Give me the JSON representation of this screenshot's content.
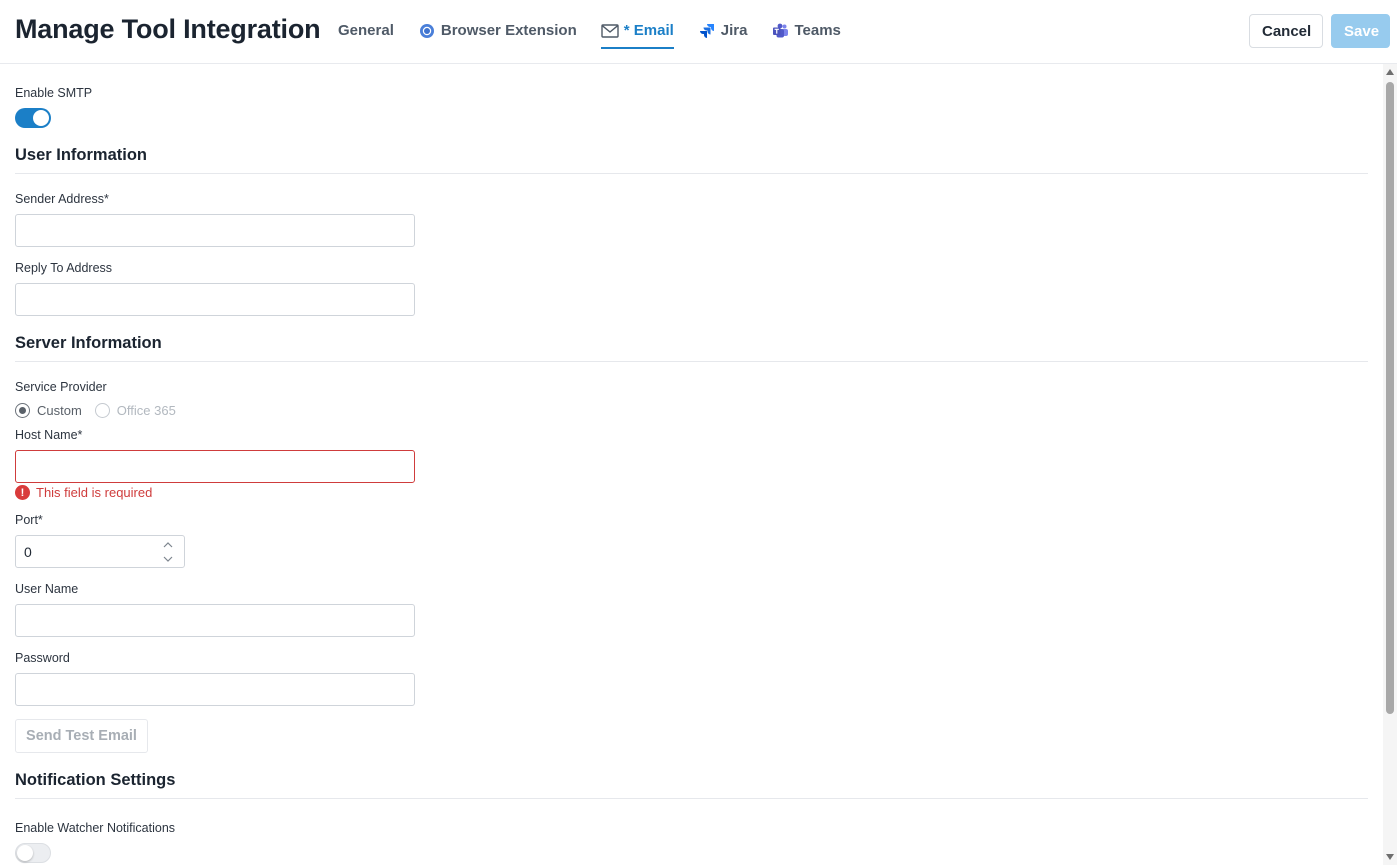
{
  "header": {
    "title": "Manage Tool Integration",
    "tabs": [
      {
        "label": "General",
        "icon": "",
        "active": false
      },
      {
        "label": "Browser Extension",
        "icon": "chrome-icon",
        "active": false
      },
      {
        "label": "* Email",
        "icon": "envelope-icon",
        "active": true
      },
      {
        "label": "Jira",
        "icon": "jira-icon",
        "active": false
      },
      {
        "label": "Teams",
        "icon": "teams-icon",
        "active": false
      }
    ],
    "cancel_label": "Cancel",
    "save_label": "Save"
  },
  "smtp": {
    "label": "Enable SMTP",
    "enabled": true
  },
  "user_info": {
    "title": "User Information",
    "sender_label": "Sender Address*",
    "sender_value": "",
    "reply_label": "Reply To Address",
    "reply_value": ""
  },
  "server_info": {
    "title": "Server Information",
    "provider_label": "Service Provider",
    "provider_options": [
      "Custom",
      "Office 365"
    ],
    "provider_selected": "Custom",
    "host_label": "Host Name*",
    "host_value": "",
    "host_error": "This field is required",
    "port_label": "Port*",
    "port_value": "0",
    "username_label": "User Name",
    "username_value": "",
    "password_label": "Password",
    "password_value": "",
    "test_button_label": "Send Test Email"
  },
  "notifications": {
    "title": "Notification Settings",
    "watcher_label": "Enable Watcher Notifications",
    "watcher_enabled": false
  },
  "colors": {
    "accent": "#1b7fc7",
    "save_disabled": "#97cbee",
    "error": "#cf3c3c"
  }
}
